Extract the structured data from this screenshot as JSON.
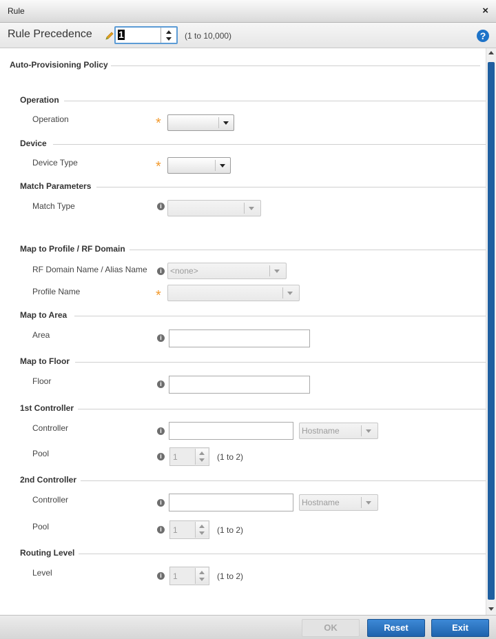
{
  "window": {
    "title": "Rule",
    "close_symbol": "×"
  },
  "precedence": {
    "label": "Rule Precedence",
    "value": "1",
    "range": "(1 to 10,000)",
    "help_symbol": "?"
  },
  "policy": {
    "title": "Auto-Provisioning Policy"
  },
  "sections": {
    "operation": {
      "title": "Operation",
      "field_label": "Operation",
      "value": ""
    },
    "device": {
      "title": "Device",
      "field_label": "Device Type",
      "value": ""
    },
    "match": {
      "title": "Match Parameters",
      "field_label": "Match Type",
      "value": ""
    },
    "map_profile": {
      "title": "Map to Profile / RF Domain",
      "rf_label": "RF Domain Name / Alias Name",
      "rf_value": "<none>",
      "profile_label": "Profile Name",
      "profile_value": ""
    },
    "map_area": {
      "title": "Map to Area",
      "field_label": "Area",
      "value": ""
    },
    "map_floor": {
      "title": "Map to Floor",
      "field_label": "Floor",
      "value": ""
    },
    "controller1": {
      "title": "1st Controller",
      "controller_label": "Controller",
      "controller_value": "",
      "type_value": "Hostname",
      "pool_label": "Pool",
      "pool_value": "1",
      "pool_range": "(1 to 2)"
    },
    "controller2": {
      "title": "2nd Controller",
      "controller_label": "Controller",
      "controller_value": "",
      "type_value": "Hostname",
      "pool_label": "Pool",
      "pool_value": "1",
      "pool_range": "(1 to 2)"
    },
    "routing": {
      "title": "Routing Level",
      "field_label": "Level",
      "value": "1",
      "range": "(1 to 2)"
    }
  },
  "icons": {
    "required": "star-icon",
    "info": "info-icon",
    "help": "help-icon",
    "edit": "pencil-icon"
  },
  "colors": {
    "accent": "#1f63ad",
    "required_star": "#f29a2e",
    "scroll_thumb": "#1f5fa0"
  },
  "footer": {
    "ok_label": "OK",
    "reset_label": "Reset",
    "exit_label": "Exit"
  }
}
